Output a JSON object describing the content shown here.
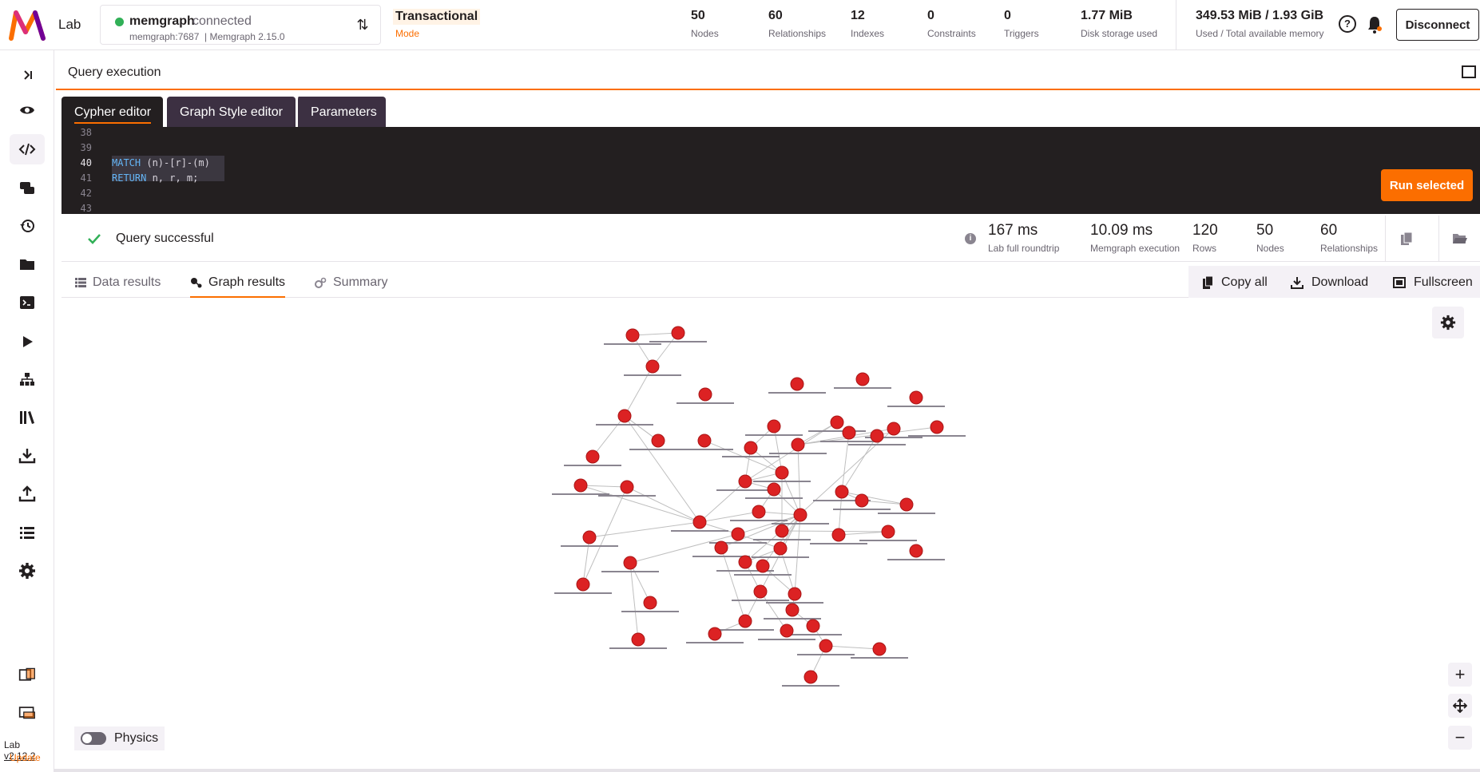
{
  "app": {
    "name": "Lab"
  },
  "connection": {
    "name": "memgraph",
    "status": "connected",
    "host": "memgraph:7687",
    "version": "Memgraph 2.15.0",
    "status_color": "#31b057"
  },
  "mode": {
    "title": "Transactional",
    "subtitle": "Mode"
  },
  "stats": [
    {
      "value": "50",
      "label": "Nodes"
    },
    {
      "value": "60",
      "label": "Relationships"
    },
    {
      "value": "12",
      "label": "Indexes"
    },
    {
      "value": "0",
      "label": "Constraints"
    },
    {
      "value": "0",
      "label": "Triggers"
    },
    {
      "value": "1.77 MiB",
      "label": "Disk storage used"
    },
    {
      "value": "349.53 MiB / 1.93 GiB",
      "label": "Used / Total available memory"
    }
  ],
  "header": {
    "disconnect_label": "Disconnect",
    "help_icon": "?"
  },
  "sidebar": {
    "items": [
      {
        "name": "expand",
        "icon": "chevron-right-bar-icon"
      },
      {
        "name": "overview",
        "icon": "eye-icon"
      },
      {
        "name": "query-execution",
        "icon": "code-icon",
        "active": true
      },
      {
        "name": "chat",
        "icon": "chat-bubbles-icon"
      },
      {
        "name": "history",
        "icon": "history-icon"
      },
      {
        "name": "collections",
        "icon": "folder-icon"
      },
      {
        "name": "query-modules",
        "icon": "terminal-icon"
      },
      {
        "name": "streams",
        "icon": "play-icon"
      },
      {
        "name": "graph-schema",
        "icon": "hierarchy-icon"
      },
      {
        "name": "library",
        "icon": "library-icon"
      },
      {
        "name": "import",
        "icon": "download-icon"
      },
      {
        "name": "export",
        "icon": "upload-icon"
      },
      {
        "name": "logs",
        "icon": "list-icon"
      },
      {
        "name": "settings",
        "icon": "gear-icon"
      },
      {
        "name": "layout-1",
        "icon": "layout-icon"
      },
      {
        "name": "layout-2",
        "icon": "layout-icon"
      }
    ],
    "version_prefix": "Lab ",
    "version": "v2.12.2",
    "update_label": "Update"
  },
  "query_execution": {
    "title": "Query execution",
    "tabs": [
      "Cypher editor",
      "Graph Style editor",
      "Parameters"
    ],
    "active_tab": "Cypher editor",
    "editor": {
      "line_numbers": [
        "38",
        "39",
        "40",
        "41",
        "42",
        "43"
      ],
      "current_line": "40",
      "line40_keyword": "MATCH",
      "line40_rest": " (n)-[r]-(m)",
      "line41_keyword": "RETURN",
      "line41_rest": " n, r, m;"
    },
    "run_label": "Run selected"
  },
  "status": {
    "message": "Query successful",
    "info_icon": "i",
    "metrics": [
      {
        "value": "167 ms",
        "label": "Lab full roundtrip"
      },
      {
        "value": "10.09 ms",
        "label": "Memgraph execution"
      },
      {
        "value": "120",
        "label": "Rows"
      },
      {
        "value": "50",
        "label": "Nodes"
      },
      {
        "value": "60",
        "label": "Relationships"
      }
    ]
  },
  "results": {
    "tabs": [
      "Data results",
      "Graph results",
      "Summary"
    ],
    "active_tab": "Graph results",
    "actions": [
      "Copy all",
      "Download",
      "Fullscreen"
    ]
  },
  "graph": {
    "node_color": "#dc2223",
    "edge_color": "#bfbfbf",
    "physics_label": "Physics",
    "physics_enabled": false,
    "zoom_in": "+",
    "zoom_out": "−",
    "fit_icon": "fit-to-screen-icon"
  },
  "colors": {
    "accent": "#fb6e00",
    "success": "#31b057",
    "editor_bg": "#231f20",
    "tab_bg": "#3c3042"
  }
}
